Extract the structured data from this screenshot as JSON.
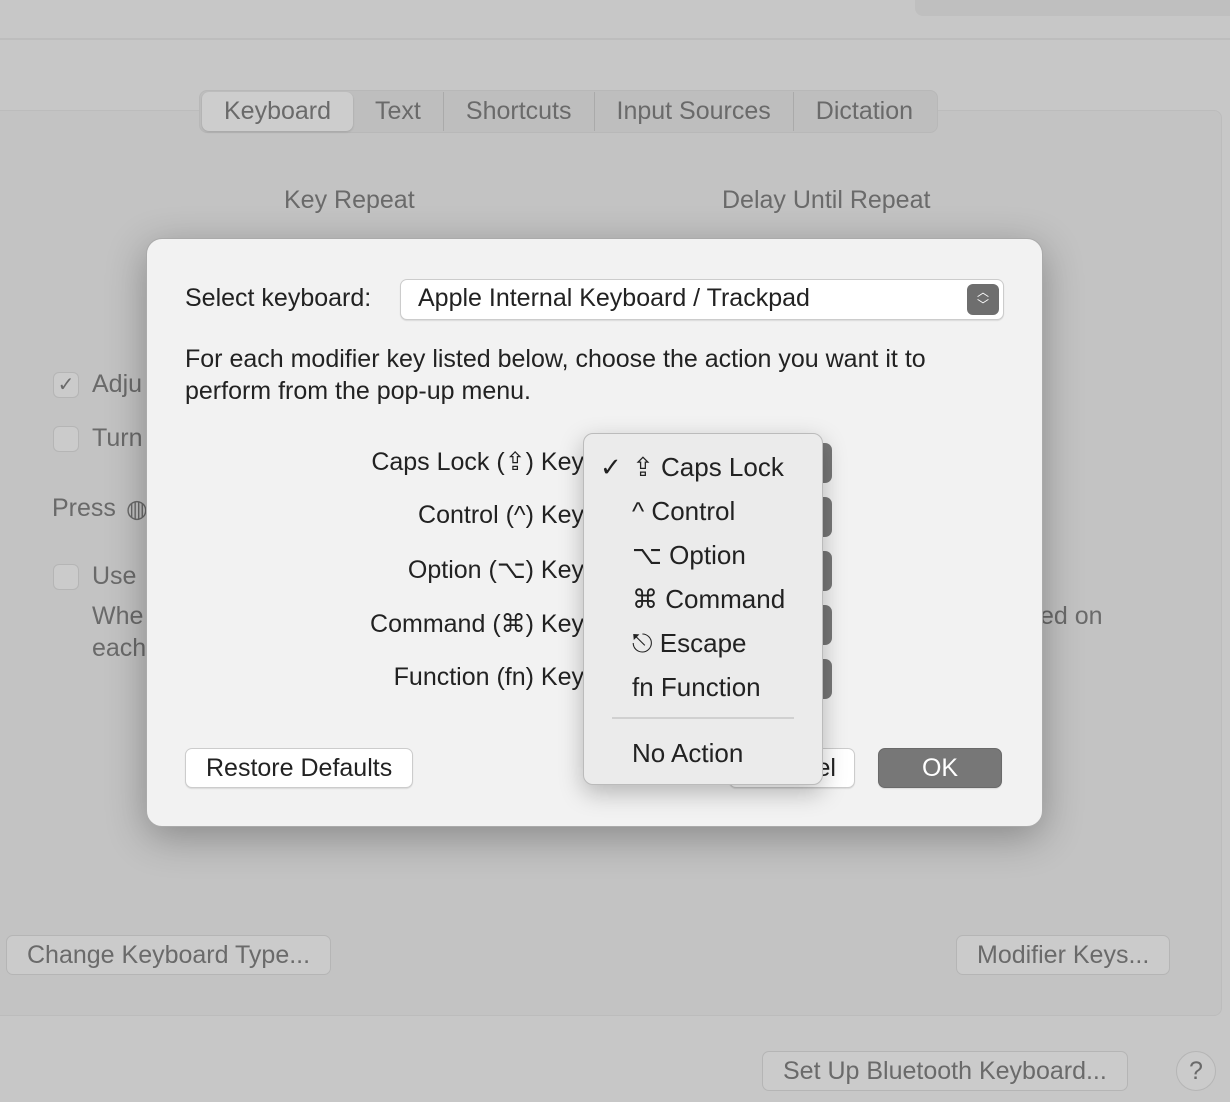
{
  "tabs": [
    {
      "label": "Keyboard",
      "active": true
    },
    {
      "label": "Text"
    },
    {
      "label": "Shortcuts"
    },
    {
      "label": "Input Sources"
    },
    {
      "label": "Dictation"
    }
  ],
  "background": {
    "key_repeat": "Key Repeat",
    "delay_until_repeat": "Delay Until Repeat",
    "adjust_partial": "Adju",
    "turn_partial": "Turn",
    "press_partial": "Press",
    "use_partial": "Use",
    "when_partial": "Whe",
    "each_partial": "each",
    "ed_on_partial": "ed on",
    "change_keyboard_type": "Change Keyboard Type...",
    "modifier_keys": "Modifier Keys...",
    "bluetooth": "Set Up Bluetooth Keyboard...",
    "help": "?"
  },
  "dialog": {
    "select_label": "Select keyboard:",
    "select_value": "Apple Internal Keyboard / Trackpad",
    "instructions_line1": "For each modifier key listed below, choose the action you want it to",
    "instructions_line2": "perform from the pop-up menu.",
    "rows": [
      {
        "label": "Caps Lock (⇪) Key"
      },
      {
        "label": "Control (^) Key"
      },
      {
        "label": "Option (⌥) Key"
      },
      {
        "label": "Command (⌘) Key"
      },
      {
        "label": "Function (fn) Key"
      }
    ],
    "restore_defaults": "Restore Defaults",
    "cancel_partial": "el",
    "ok": "OK"
  },
  "menu": {
    "items": [
      {
        "label": "⇪ Caps Lock",
        "checked": "✓"
      },
      {
        "label": "^ Control"
      },
      {
        "label": "⌥ Option"
      },
      {
        "label": "⌘ Command"
      },
      {
        "label": "⎋ Escape"
      },
      {
        "label": "fn Function"
      },
      {
        "label": "No Action"
      }
    ]
  }
}
